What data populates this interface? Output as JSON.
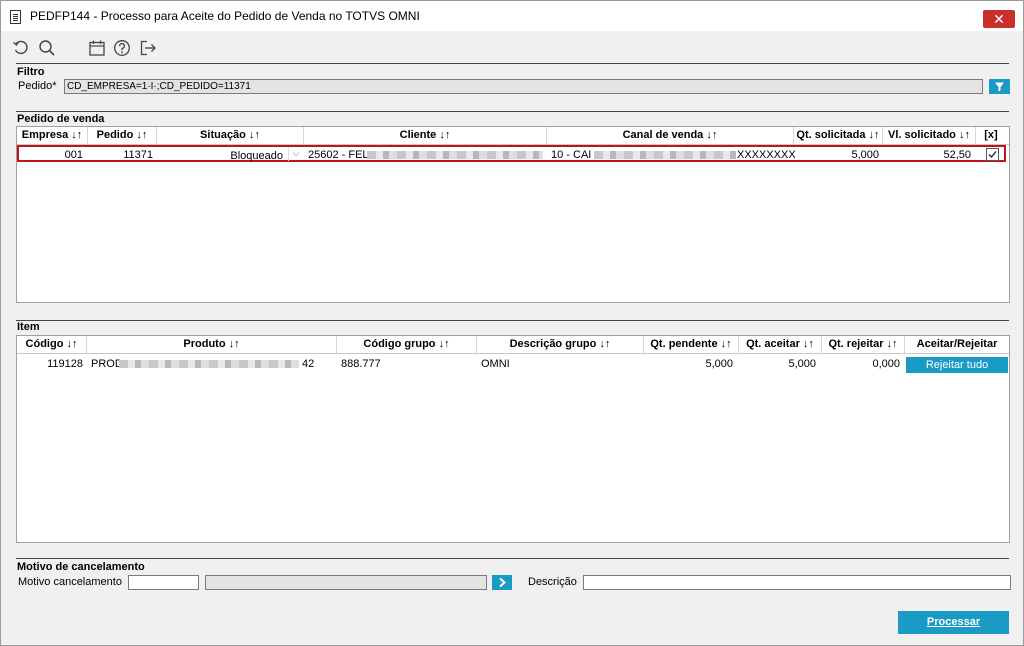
{
  "window": {
    "title": "PEDFP144 - Processo para Aceite do Pedido de Venda no TOTVS OMNI",
    "close_label": "✕"
  },
  "toolbar": {
    "icons": [
      "undo-icon",
      "search-icon",
      "calendar-icon",
      "help-icon",
      "exit-icon"
    ]
  },
  "filtro": {
    "title": "Filtro",
    "pedido_label": "Pedido*",
    "pedido_value": "CD_EMPRESA=1·I·;CD_PEDIDO=11371"
  },
  "pedido_venda": {
    "title": "Pedido de venda",
    "headers": [
      "Empresa ↓↑",
      "Pedido ↓↑",
      "Situação ↓↑",
      "Cliente ↓↑",
      "Canal de venda ↓↑",
      "Qt. solicitada ↓↑",
      "Vl. solicitado ↓↑",
      "[x]"
    ],
    "row": {
      "empresa": "001",
      "pedido": "11371",
      "situacao": "Bloqueado",
      "cliente": "25602 - FEL",
      "canal": "10 - CAI",
      "canal_tail": "XXXXXXXX",
      "qt_solicitada": "5,000",
      "vl_solicitado": "52,50",
      "checked": true
    }
  },
  "item": {
    "title": "Item",
    "headers": [
      "Código ↓↑",
      "Produto ↓↑",
      "Código grupo ↓↑",
      "Descrição grupo ↓↑",
      "Qt. pendente ↓↑",
      "Qt. aceitar ↓↑",
      "Qt. rejeitar ↓↑",
      "Aceitar/Rejeitar"
    ],
    "row": {
      "codigo": "119128",
      "produto": "PROD",
      "produto_tail": "42",
      "codigo_grupo": "888.777",
      "descricao_grupo": "OMNI",
      "qt_pendente": "5,000",
      "qt_aceitar": "5,000",
      "qt_rejeitar": "0,000",
      "action_label": "Rejeitar tudo"
    }
  },
  "motivo": {
    "title": "Motivo de cancelamento",
    "motivo_label": "Motivo cancelamento",
    "motivo_value": "",
    "motivo_desc_value": "",
    "descricao_label": "Descrição",
    "descricao_value": ""
  },
  "footer": {
    "processar_label": "Processar"
  },
  "colors": {
    "accent": "#1a9bc5",
    "selection": "#c0141b",
    "close": "#c9302c"
  }
}
